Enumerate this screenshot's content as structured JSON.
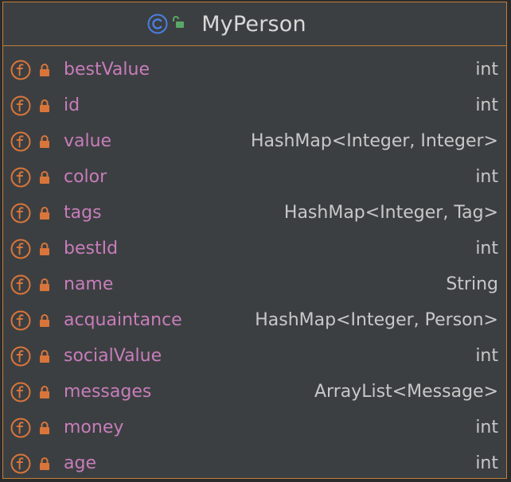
{
  "class_box": {
    "name": "MyPerson",
    "class_icon": "class-c-icon",
    "visibility_icon": "unlocked-padlock-icon",
    "fields": [
      {
        "name": "bestValue",
        "type": "int"
      },
      {
        "name": "id",
        "type": "int"
      },
      {
        "name": "value",
        "type": "HashMap<Integer, Integer>"
      },
      {
        "name": "color",
        "type": "int"
      },
      {
        "name": "tags",
        "type": "HashMap<Integer, Tag>"
      },
      {
        "name": "bestId",
        "type": "int"
      },
      {
        "name": "name",
        "type": "String"
      },
      {
        "name": "acquaintance",
        "type": "HashMap<Integer, Person>"
      },
      {
        "name": "socialValue",
        "type": "int"
      },
      {
        "name": "messages",
        "type": "ArrayList<Message>"
      },
      {
        "name": "money",
        "type": "int"
      },
      {
        "name": "age",
        "type": "int"
      }
    ]
  },
  "colors": {
    "border": "#c17d3c",
    "background": "#3c3f41",
    "field_name": "#c77dbb",
    "field_type": "#c8c8c8",
    "class_name": "#d8d8d8",
    "field_icon": "#d9753b",
    "class_icon": "#4a7fe0",
    "lock": "#d9753b",
    "unlock": "#59a869"
  }
}
